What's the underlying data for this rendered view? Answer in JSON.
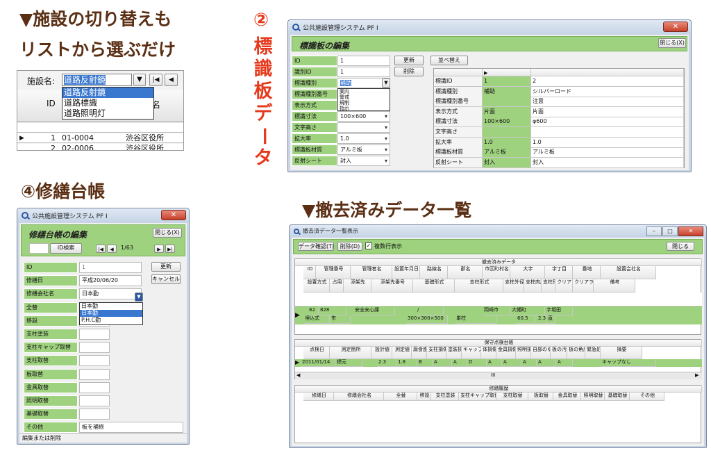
{
  "headings": {
    "switch_line1": "▼施設の切り替えも",
    "switch_line2": "リストから選ぶだけ",
    "num2": "②",
    "vertical": [
      "標",
      "識",
      "板",
      "デ",
      "ー",
      "タ"
    ],
    "daicho": "④修繕台帳",
    "removed": "▼撤去済みデータ一覧"
  },
  "colors": {
    "heading": "#5b2f14",
    "green_label": "#9fd27f",
    "selected": "#3a78d0"
  },
  "facility_switcher": {
    "label": "施設名:",
    "selected": "道路反射鏡",
    "options": [
      "道路反射鏡",
      "道路標識",
      "道路照明灯"
    ],
    "col_id": "ID",
    "col_manager": "理者名",
    "rows": [
      {
        "num": "1",
        "code": "01-0004",
        "name": "渋谷区役所"
      },
      {
        "num": "2",
        "code": "02-0006",
        "name": "渋谷区役所"
      }
    ],
    "icons": [
      "dropdown-icon",
      "first-record-icon",
      "prev-record-icon"
    ]
  },
  "signboard_window": {
    "title": "公共施設管理システム PF I",
    "heading": "標識板の編集",
    "close_label": "閉じる(X)",
    "update_label": "更新",
    "delete_label": "削除",
    "sort_label": "並べ替え",
    "fields": [
      {
        "label": "ID",
        "value": "1"
      },
      {
        "label": "識別ID",
        "value": "1"
      },
      {
        "label": "標識種別",
        "value": "補助"
      },
      {
        "label": "標識種別番号",
        "value": ""
      },
      {
        "label": "表示方式",
        "value": ""
      },
      {
        "label": "標識寸法",
        "value": "100×600"
      },
      {
        "label": "文字高さ",
        "value": ""
      },
      {
        "label": "拡大率",
        "value": "1.0"
      },
      {
        "label": "標識板材質",
        "value": "アルミ板"
      },
      {
        "label": "反射シート",
        "value": "封入"
      }
    ],
    "type_dropdown": [
      "案内",
      "警戒",
      "規制",
      "指示"
    ],
    "compare": [
      {
        "label": "標識ID",
        "a": "1",
        "b": "2"
      },
      {
        "label": "標識種別",
        "a": "補助",
        "b": "シルバーロード"
      },
      {
        "label": "標識種別番号",
        "a": "",
        "b": "注意"
      },
      {
        "label": "表示方式",
        "a": "片面",
        "b": "片面"
      },
      {
        "label": "標識寸法",
        "a": "100×600",
        "b": "φ600"
      },
      {
        "label": "文字高さ",
        "a": "",
        "b": ""
      },
      {
        "label": "拡大率",
        "a": "1.0",
        "b": "1.0"
      },
      {
        "label": "標識板材質",
        "a": "アルミ板",
        "b": "アルミ板"
      },
      {
        "label": "反射シート",
        "a": "封入",
        "b": "封入"
      }
    ]
  },
  "repair_window": {
    "title": "公共施設管理システム PF I",
    "heading": "修繕台帳の編集",
    "close_label": "閉じる(X)",
    "search_label": "ID検索",
    "record_pos": "1/63",
    "update_label": "更新",
    "cancel_label": "キャンセル",
    "fields": [
      {
        "label": "ID",
        "value": "1"
      },
      {
        "label": "修繕日",
        "value": "平成20/06/20"
      },
      {
        "label": "修繕会社名",
        "value": "日本勤"
      },
      {
        "label": "全替",
        "value": ""
      },
      {
        "label": "移設",
        "value": ""
      },
      {
        "label": "支柱塗装",
        "value": ""
      },
      {
        "label": "支柱キャップ取替",
        "value": ""
      },
      {
        "label": "支柱取替",
        "value": ""
      },
      {
        "label": "板取替",
        "value": ""
      },
      {
        "label": "金具取替",
        "value": ""
      },
      {
        "label": "照明取替",
        "value": ""
      },
      {
        "label": "基礎取替",
        "value": ""
      },
      {
        "label": "その他",
        "value": "板を補修"
      }
    ],
    "company_dropdown": [
      "日本勤",
      "日本勤",
      "P.H.C勤"
    ],
    "status": "編集または削除"
  },
  "removed_window": {
    "title": "撤去済データ一覧表示",
    "confirm_label": "データ確認(T)",
    "delete_label": "削除(D)",
    "checkbox_label": "複数行表示",
    "close_label": "閉じる",
    "section1_title": "撤去済みデータ",
    "header1": [
      "ID",
      "管理番号",
      "管理者名",
      "設置年月日",
      "路線名",
      "郡名",
      "市区町村名",
      "大字",
      "字丁目",
      "番地",
      "設置会社名"
    ],
    "header2": [
      "設置方式",
      "占用",
      "添架先",
      "添架先番号",
      "基礎形式",
      "支柱形式",
      "支柱外径",
      "支柱肉厚",
      "支柱形状",
      "クリアランス高",
      "クリアランス幅",
      "備考"
    ],
    "row1": [
      "82",
      "828",
      "安全安心課",
      "/",
      "岡崎市",
      "大幡町",
      "字堀田"
    ],
    "row2": [
      "埋込式",
      "市",
      "300×300×500",
      "単柱",
      "60.5",
      "2.3",
      "直"
    ],
    "section2_title": "保守点検台帳",
    "header3": [
      "点検日",
      "測定箇所",
      "設計値",
      "測定値",
      "腐食度判定",
      "支柱損傷",
      "塗装損傷",
      "キャップ損傷",
      "体損傷",
      "金具損傷",
      "照明損傷",
      "自部のゆるみ",
      "板の汚れ",
      "板の角度",
      "緊急処置",
      "摘要"
    ],
    "row3": [
      "2011/01/14",
      "標元",
      "2.3",
      "1.8",
      "B",
      "A",
      "A",
      "D",
      "A",
      "A",
      "A",
      "A",
      "A",
      "キャップなし"
    ],
    "scroll_mark": "III",
    "section3_title": "修繕履歴",
    "header4": [
      "修繕日",
      "修繕会社名",
      "全替",
      "移設",
      "支柱塗装",
      "支柱キャップ取替",
      "支柱取替",
      "板取替",
      "金具取替",
      "照明取替",
      "基礎取替",
      "その他"
    ]
  }
}
